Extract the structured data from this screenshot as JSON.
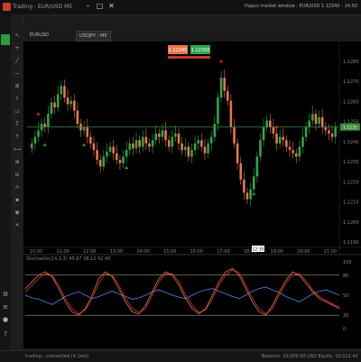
{
  "window": {
    "title": "Trading - EUR/USD M5"
  },
  "titlebar": {
    "close_label": "✕",
    "minimize_label": "–",
    "maximize_label": "□",
    "status_text": "Hapus market window - EUR/USD 1.12345 - 14:50"
  },
  "tabs": [
    {
      "label": "EURUSD"
    },
    {
      "label": "USDJPY - M5"
    }
  ],
  "order_buttons": {
    "sell": "1.12345",
    "buy": "1.12358"
  },
  "chart_data": {
    "type": "candlestick",
    "price_axis": [
      "1.1280",
      "1.1270",
      "1.1260",
      "1.1250",
      "1.1240",
      "1.1230",
      "1.1220",
      "1.1210",
      "1.1200",
      "1.1190"
    ],
    "time_axis": [
      "10:00",
      "11:00",
      "12:00",
      "13:00",
      "14:00",
      "15:00",
      "16:00",
      "17:00",
      "18:00",
      "19:00",
      "20:00",
      "21:00"
    ],
    "current_price": "1.1235",
    "current_time": "12:30",
    "colors": {
      "bull": "#2fa84a",
      "bear": "#e8774c",
      "price_line": "#3c8c3c",
      "buy_arrow": "#2fa84a",
      "sell_arrow": "#e03030"
    },
    "closes": [
      60,
      64,
      68,
      72,
      70,
      78,
      85,
      82,
      90,
      95,
      88,
      84,
      86,
      80,
      72,
      68,
      70,
      64,
      60,
      56,
      50,
      46,
      52,
      55,
      58,
      54,
      50,
      48,
      52,
      56,
      60,
      57,
      62,
      58,
      64,
      60,
      58,
      62,
      66,
      64,
      68,
      62,
      58,
      64,
      66,
      60,
      56,
      58,
      52,
      56,
      60,
      62,
      58,
      54,
      60,
      64,
      72,
      88,
      100,
      92,
      86,
      70,
      60,
      48,
      38,
      30,
      26,
      32,
      40,
      52,
      62,
      70,
      74,
      70,
      66,
      60,
      64,
      62,
      58,
      56,
      54,
      52,
      58,
      64,
      70,
      74,
      78,
      72,
      76,
      70,
      68,
      66,
      64,
      70
    ],
    "buy_arrows": [
      4,
      16,
      29,
      68,
      69
    ],
    "sell_arrows": [
      2,
      58,
      75
    ],
    "oscillator": {
      "label": "Stochastic(14,3,3) 45.67 38.12 52.40",
      "levels": [
        "80",
        "20"
      ],
      "scale": [
        "100",
        "80",
        "50",
        "20",
        "0"
      ],
      "colors": {
        "blue": "#4a86e8",
        "orange": "#e07a3c",
        "red": "#d33"
      },
      "blue": [
        50,
        46,
        44,
        40,
        36,
        42,
        48,
        52,
        55,
        50,
        45,
        48,
        52,
        56,
        52,
        48,
        44,
        46,
        50,
        55,
        58,
        54,
        50,
        47,
        45,
        50,
        55,
        58,
        60,
        56,
        52,
        48,
        45,
        50,
        56,
        60,
        62,
        58,
        54,
        48,
        44,
        40,
        46,
        52,
        56,
        58,
        54,
        50
      ],
      "orange": [
        60,
        70,
        80,
        85,
        78,
        60,
        40,
        25,
        20,
        30,
        50,
        75,
        85,
        78,
        60,
        40,
        25,
        22,
        35,
        55,
        75,
        85,
        80,
        65,
        45,
        30,
        22,
        30,
        50,
        70,
        85,
        90,
        80,
        60,
        40,
        25,
        20,
        35,
        55,
        72,
        85,
        80,
        68,
        55,
        45,
        40,
        35,
        30
      ],
      "red": [
        55,
        65,
        75,
        82,
        80,
        65,
        45,
        30,
        22,
        28,
        45,
        68,
        82,
        80,
        65,
        45,
        30,
        24,
        30,
        50,
        70,
        82,
        82,
        70,
        50,
        35,
        24,
        28,
        45,
        65,
        80,
        88,
        84,
        65,
        45,
        30,
        22,
        30,
        50,
        68,
        80,
        82,
        72,
        58,
        48,
        42,
        37,
        32
      ]
    }
  },
  "footer": {
    "left_text": "trading - connected (4.1ms)",
    "right_text": "Balance: 10,000.00 USD  Equity: 10,012.40"
  }
}
